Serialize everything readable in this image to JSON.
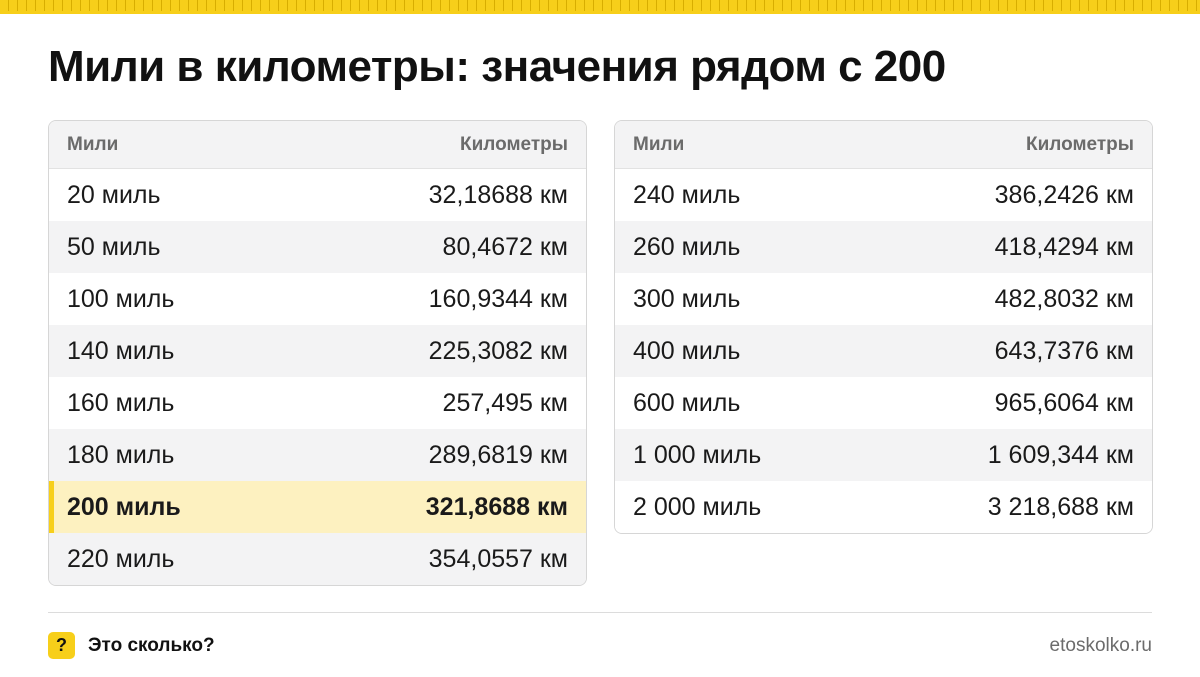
{
  "title": "Мили в километры: значения рядом с 200",
  "table_left": {
    "headers": [
      "Мили",
      "Километры"
    ],
    "rows": [
      {
        "miles": "20 миль",
        "km": "32,18688 км"
      },
      {
        "miles": "50 миль",
        "km": "80,4672 км"
      },
      {
        "miles": "100 миль",
        "km": "160,9344 км"
      },
      {
        "miles": "140 миль",
        "km": "225,3082 км"
      },
      {
        "miles": "160 миль",
        "km": "257,495 км"
      },
      {
        "miles": "180 миль",
        "km": "289,6819 км"
      },
      {
        "miles": "200 миль",
        "km": "321,8688 км",
        "highlighted": true
      },
      {
        "miles": "220 миль",
        "km": "354,0557 км"
      }
    ]
  },
  "table_right": {
    "headers": [
      "Мили",
      "Километры"
    ],
    "rows": [
      {
        "miles": "240 миль",
        "km": "386,2426 км"
      },
      {
        "miles": "260 миль",
        "km": "418,4294 км"
      },
      {
        "miles": "300 миль",
        "km": "482,8032 км"
      },
      {
        "miles": "400 миль",
        "km": "643,7376 км"
      },
      {
        "miles": "600 миль",
        "km": "965,6064 км"
      },
      {
        "miles": "1 000 миль",
        "km": "1 609,344 км"
      },
      {
        "miles": "2 000 миль",
        "km": "3 218,688 км"
      }
    ]
  },
  "footer": {
    "badge_symbol": "?",
    "brand": "Это сколько?",
    "site": "etoskolko.ru"
  },
  "colors": {
    "accent": "#f7cf1a",
    "highlight_row": "#fdf1c0",
    "header_bg": "#f3f3f4",
    "muted_text": "#6b6b6b"
  },
  "icons": {
    "top_decoration": "ruler-stripe",
    "brand": "question-mark-badge"
  }
}
